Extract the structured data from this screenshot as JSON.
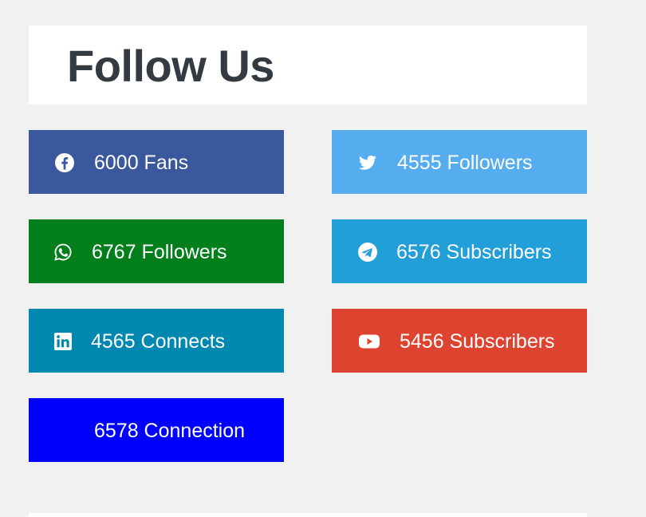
{
  "header": {
    "title": "Follow Us"
  },
  "buttons": [
    {
      "network": "facebook",
      "icon": "facebook-icon",
      "label": "6000 Fans",
      "color": "#3b579d"
    },
    {
      "network": "twitter",
      "icon": "twitter-icon",
      "label": "4555 Followers",
      "color": "#55acee"
    },
    {
      "network": "whatsapp",
      "icon": "whatsapp-icon",
      "label": "6767 Followers",
      "color": "#027e1b"
    },
    {
      "network": "telegram",
      "icon": "telegram-icon",
      "label": "6576 Subscribers",
      "color": "#229ed9"
    },
    {
      "network": "linkedin",
      "icon": "linkedin-icon",
      "label": "4565 Connects",
      "color": "#0088b0"
    },
    {
      "network": "youtube",
      "icon": "youtube-icon",
      "label": "5456 Subscribers",
      "color": "#dd432f"
    },
    {
      "network": "unknown",
      "icon": "",
      "label": "6578 Connection",
      "color": "#0000ff"
    }
  ]
}
